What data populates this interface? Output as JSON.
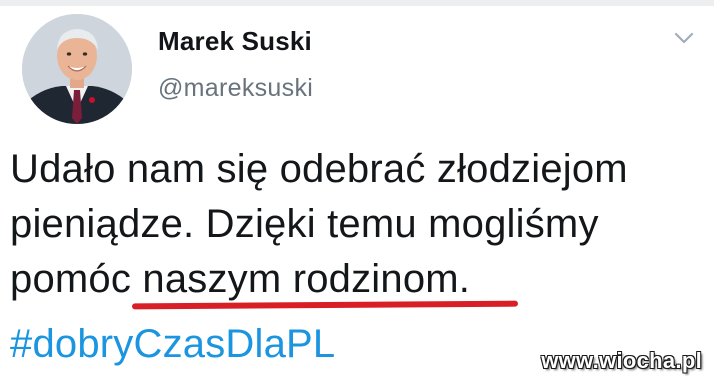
{
  "tweet": {
    "author": {
      "display_name": "Marek Suski",
      "handle": "@mareksuski"
    },
    "menu_icon": "chevron-down-icon",
    "body_lines": [
      "Udało nam się odebrać złodziejom",
      "pieniądze. Dzięki temu mogliśmy",
      "pomóc naszym rodzinom."
    ],
    "hashtag": "#dobryCzasDlaPL"
  },
  "watermark": {
    "text": "www.wiocha.pl"
  },
  "colors": {
    "hashtag": "#1b95e0",
    "underline": "#d91f26",
    "handle": "#68737d",
    "name": "#111418"
  }
}
